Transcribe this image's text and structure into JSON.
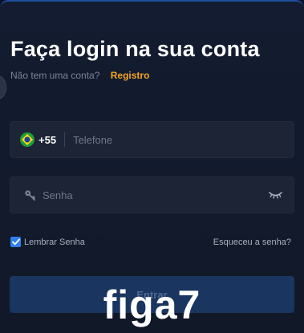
{
  "login": {
    "title": "Faça login na sua conta",
    "no_account_text": "Não tem uma conta?",
    "register_link": "Registro",
    "phone": {
      "country_code": "+55",
      "country": "Brazil",
      "placeholder": "Telefone",
      "value": ""
    },
    "password": {
      "placeholder": "Senha",
      "value": ""
    },
    "remember_label": "Lembrar Senha",
    "remember_checked": true,
    "forgot_link": "Esqueceu a senha?",
    "submit_label": "Entrar"
  },
  "watermark": "figa7",
  "colors": {
    "background": "#131c30",
    "field": "#1c2436",
    "accent_link": "#f5a524",
    "checkbox": "#2f7ff0",
    "button": "#1a355f"
  },
  "icons": {
    "flag": "brazil-flag-icon",
    "key": "key-icon",
    "eye": "eye-closed-icon",
    "check": "check-icon"
  }
}
